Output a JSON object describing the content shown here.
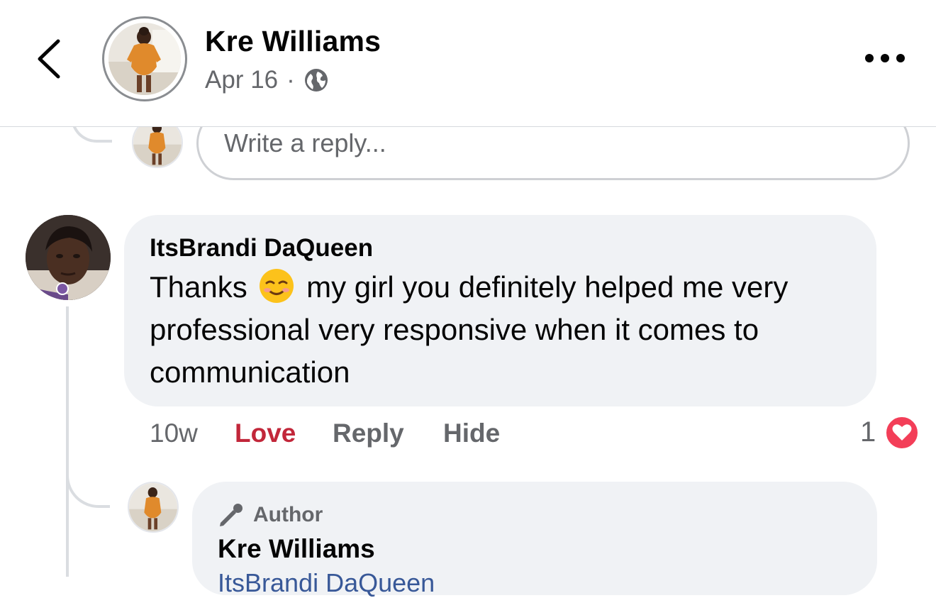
{
  "header": {
    "title": "Kre Williams",
    "date": "Apr 16",
    "separator": "·",
    "privacy_icon": "globe-icon",
    "back_icon": "chevron-left-icon",
    "more_icon": "more-horizontal-icon"
  },
  "reply_box": {
    "placeholder": "Write a reply..."
  },
  "comment": {
    "author": "ItsBrandi DaQueen",
    "text_before_emoji": "Thanks",
    "emoji": "smiling-face-icon",
    "text_after_emoji": "my girl you definitely helped me very professional very responsive when it comes to communication",
    "time": "10w",
    "love_label": "Love",
    "reply_label": "Reply",
    "hide_label": "Hide",
    "reaction_count": "1",
    "reaction_icon": "heart-icon"
  },
  "reply": {
    "badge_label": "Author",
    "badge_icon": "microphone-icon",
    "author": "Kre Williams",
    "text_preview": "ItsBrandi DaQueen"
  },
  "colors": {
    "love": "#c2273a",
    "bubble": "#f0f2f5",
    "secondary_text": "#65676b",
    "heart": "#f33e58"
  }
}
